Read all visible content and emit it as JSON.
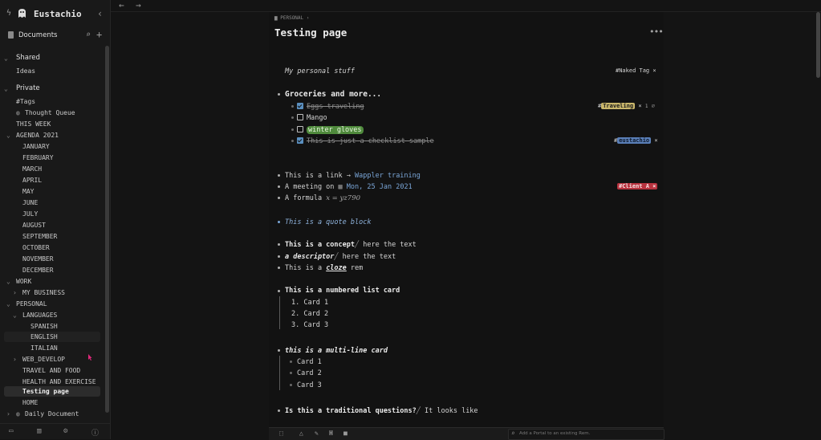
{
  "app": {
    "title": "Eustachio"
  },
  "sidebar": {
    "documents_label": "Documents",
    "sections": {
      "shared": "Shared",
      "private": "Private"
    },
    "shared_items": [
      "Ideas"
    ],
    "items": {
      "tags": "#Tags",
      "thought_queue": "Thought Queue",
      "this_week": "THIS WEEK",
      "agenda": "AGENDA 2021",
      "months": [
        "JANUARY",
        "FEBRUARY",
        "MARCH",
        "APRIL",
        "MAY",
        "JUNE",
        "JULY",
        "AUGUST",
        "SEPTEMBER",
        "OCTOBER",
        "NOVEMBER",
        "DECEMBER"
      ],
      "work": "WORK",
      "my_business": "MY BUSINESS",
      "personal": "PERSONAL",
      "languages": "LANGUAGES",
      "spanish": "SPANISH",
      "english": "ENGLISH",
      "italian": "ITALIAN",
      "web_develop": "WEB_DEVELOP",
      "travel_food": "TRAVEL AND FOOD",
      "health": "HEALTH AND EXERCISE",
      "testing_page": "Testing page",
      "home": "HOME",
      "daily_document": "Daily Document"
    }
  },
  "page": {
    "breadcrumb": "PERSONAL",
    "title": "Testing page",
    "more_icon": "ellipsis-icon",
    "lines": {
      "personal_stuff": "My personal stuff",
      "naked_tag": "#Naked Tag",
      "groceries": "Groceries and more...",
      "eggs": "Eggs traveling",
      "traveling_tag_hash": "#",
      "traveling_tag": "Traveling",
      "traveling_count": "1",
      "mango": "Mango",
      "winter_gloves": "winter gloves",
      "checklist": "This is just a checklist sample",
      "eustachio_tag_hash": "#",
      "eustachio_tag": "eustachio",
      "link_prefix": "This is a link →",
      "link_text": "Wappler training",
      "meeting_prefix": "A meeting on",
      "meeting_date": "Mon, 25 Jan 2021",
      "client_tag": "#Client A",
      "formula_prefix": "A formula",
      "formula": "x = yz790",
      "quote": "This is a quote block",
      "concept_a": "This is a concept",
      "concept_b": "here the text",
      "descriptor_a": "a descriptor",
      "descriptor_b": "here the text",
      "cloze_a": "This is a",
      "cloze_b": "cloze",
      "cloze_c": "rem",
      "numbered": "This is a numbered list card",
      "num_cards": [
        "1. Card 1",
        "2. Card 2",
        "3. Card 3"
      ],
      "multiline": "this is a multi-line card",
      "multi_cards": [
        "Card 1",
        "Card 2",
        "Card 3"
      ],
      "question_a": "Is this a traditional questions?",
      "question_b": "It looks like"
    }
  },
  "editor": {
    "portal_placeholder": "Add a Portal to an existing Rem."
  },
  "colors": {
    "accent": "#7aa6d8",
    "traveling": "#c9b66b",
    "winter": "#4f8a3c",
    "eustachio": "#5a7fb8",
    "client": "#b8333f",
    "cursor": "#e0287a"
  }
}
